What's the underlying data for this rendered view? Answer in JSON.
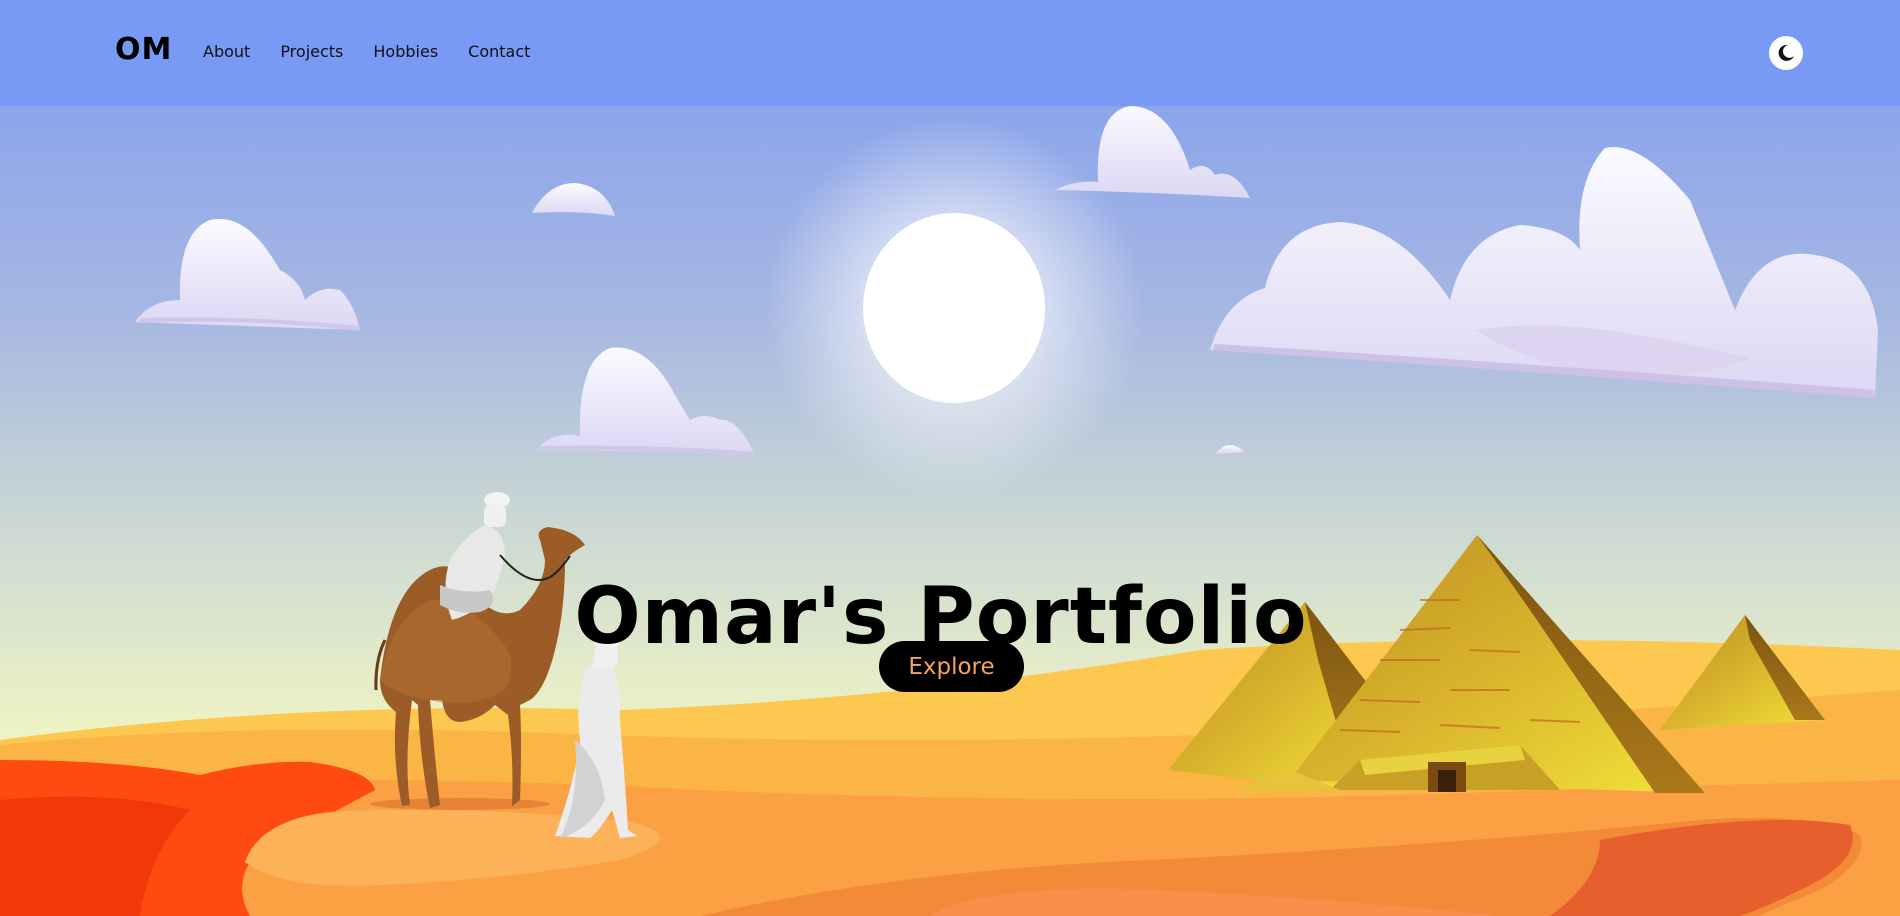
{
  "navbar": {
    "logo": "OM",
    "links": [
      "About",
      "Projects",
      "Hobbies",
      "Contact"
    ],
    "theme_toggle_icon": "moon-icon"
  },
  "hero": {
    "title": "Omar's Portfolio",
    "explore_label": "Explore"
  },
  "colors": {
    "navbar": "#789af5",
    "sky_top": "#8aa5ec",
    "sky_bottom": "#eef3c7",
    "sand": "#fcc24e",
    "dune_red": "#ff4c12",
    "button_bg": "#000000",
    "button_text": "#f5a25a"
  },
  "illustration": {
    "elements": [
      "sun",
      "clouds",
      "camel-with-rider",
      "walking-man",
      "pyramids",
      "desert-dunes"
    ]
  }
}
